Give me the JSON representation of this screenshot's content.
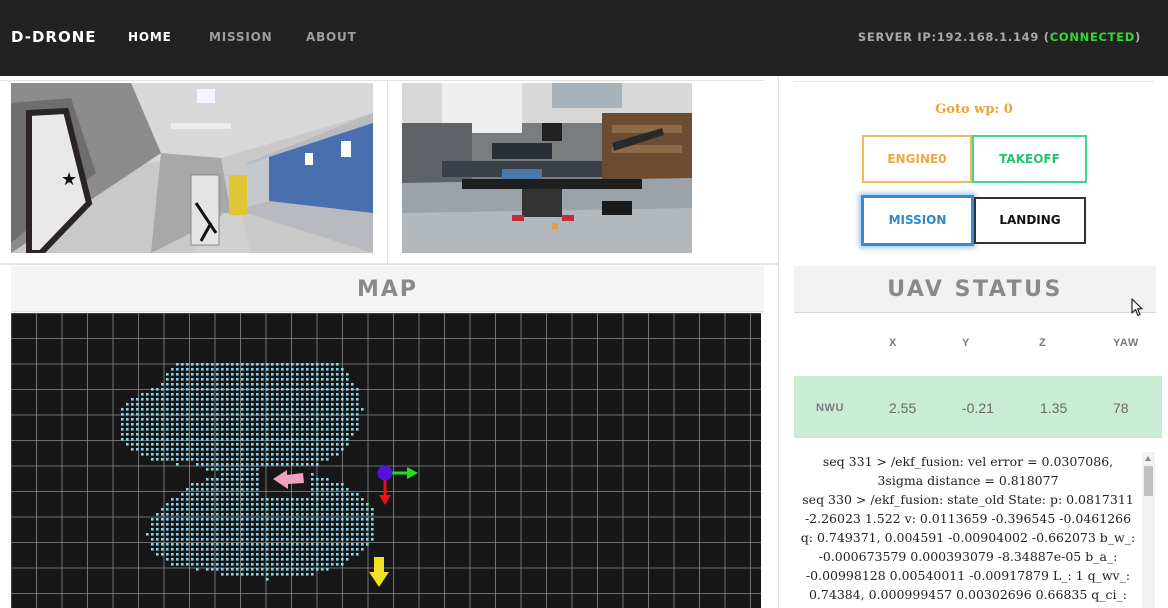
{
  "nav": {
    "brand": "D-DRONE",
    "links": [
      "HOME",
      "MISSION",
      "ABOUT"
    ],
    "active": "HOME",
    "server_label": "SERVER IP:192.168.1.149 (",
    "server_status": "CONNECTED",
    "server_close": ")"
  },
  "cameras": [
    "hallway-camera-view",
    "drone-camera-view"
  ],
  "map": {
    "title": "MAP"
  },
  "control": {
    "goto_label": "Goto wp: 0",
    "engine_label": "ENGINE0",
    "takeoff_label": "TAKEOFF",
    "mission_label": "MISSION",
    "landing_label": "LANDING"
  },
  "status": {
    "title": "UAV STATUS",
    "columns": [
      "X",
      "Y",
      "Z",
      "YAW"
    ],
    "row": {
      "label": "NWU",
      "x": "2.55",
      "y": "-0.21",
      "z": "1.35",
      "yaw": "78"
    }
  },
  "log": [
    "seq 331 > /ekf_fusion: vel error = 0.0307086, 3sigma distance = 0.818077",
    "seq 330 > /ekf_fusion: state_old State: p: 0.0817311 -2.26023 1.522 v: 0.0113659 -0.396545 -0.0461266 q: 0.749371, 0.004591 -0.00904002 -0.662073 b_w_: -0.000673579 0.000393079 -8.34887e-05 b_a_: -0.00998128 0.00540011 -0.00917879 L_: 1 q_wv_: 0.74384, 0.000999457 0.00302696 0.66835 q_ci_:"
  ],
  "colors": {
    "navbar": "#222222",
    "connected": "#33d833",
    "goto": "#e8a33c",
    "engine": "#f0b860",
    "takeoff": "#3dd88a",
    "mission": "#3a8cd0",
    "status_row": "#c8ecd4",
    "map_bg": "#171717",
    "map_points": "#8fd3ea"
  }
}
